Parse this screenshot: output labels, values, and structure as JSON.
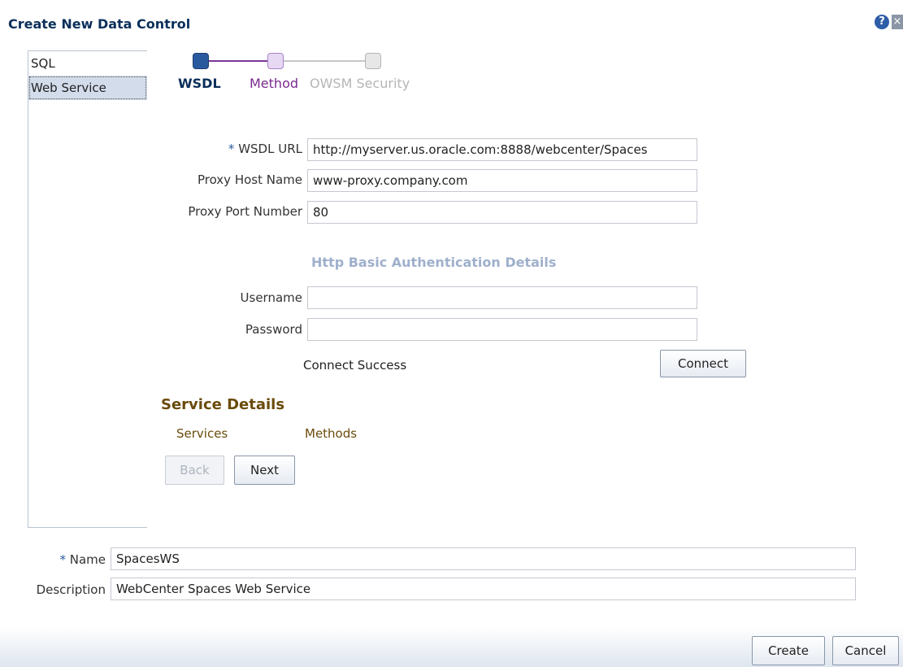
{
  "dialog": {
    "title": "Create New Data Control"
  },
  "icons": {
    "help": "?",
    "close": "×"
  },
  "type_list": {
    "items": [
      {
        "label": "SQL"
      },
      {
        "label": "Web Service"
      }
    ]
  },
  "train": {
    "steps": [
      {
        "label": "WSDL"
      },
      {
        "label": "Method"
      },
      {
        "label": "OWSM Security"
      }
    ]
  },
  "form": {
    "required_marker": "*",
    "wsdl_url": {
      "label": "WSDL URL",
      "value": "http://myserver.us.oracle.com:8888/webcenter/Spaces"
    },
    "proxy_host": {
      "label": "Proxy Host Name",
      "value": "www-proxy.company.com"
    },
    "proxy_port": {
      "label": "Proxy Port Number",
      "value": "80"
    },
    "http_auth_heading": "Http Basic Authentication Details",
    "username": {
      "label": "Username",
      "value": ""
    },
    "password": {
      "label": "Password",
      "value": ""
    },
    "connect_status": "Connect Success",
    "connect_button": "Connect"
  },
  "service_details": {
    "heading": "Service Details",
    "services_label": "Services",
    "methods_label": "Methods",
    "back_button": "Back",
    "next_button": "Next"
  },
  "bottom": {
    "name": {
      "label": "Name",
      "value": "SpacesWS"
    },
    "description": {
      "label": "Description",
      "value": "WebCenter Spaces Web Service"
    }
  },
  "footer": {
    "create_button": "Create",
    "cancel_button": "Cancel"
  }
}
